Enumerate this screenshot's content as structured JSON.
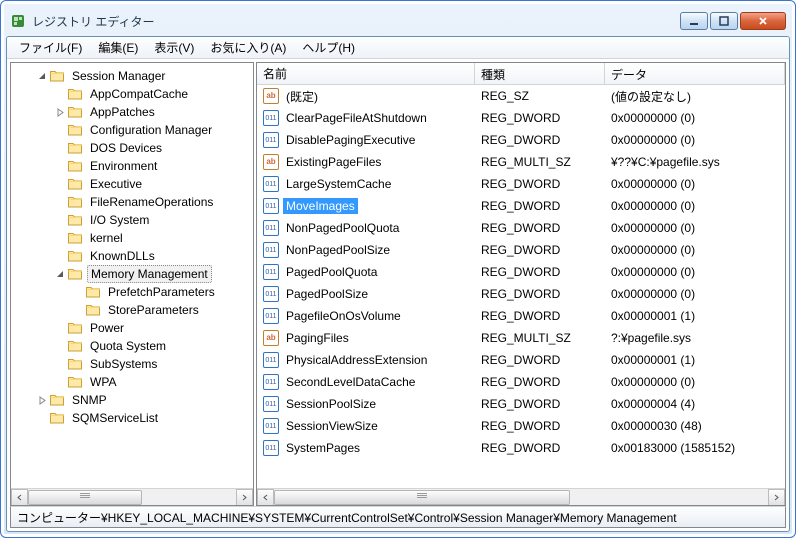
{
  "title": "レジストリ エディター",
  "menus": [
    "ファイル(F)",
    "編集(E)",
    "表示(V)",
    "お気に入り(A)",
    "ヘルプ(H)"
  ],
  "columns": {
    "name": "名前",
    "type": "種類",
    "data": "データ"
  },
  "tree": {
    "items": [
      {
        "label": "Session Manager",
        "indent": 0,
        "exp": "open"
      },
      {
        "label": "AppCompatCache",
        "indent": 1,
        "exp": "none"
      },
      {
        "label": "AppPatches",
        "indent": 1,
        "exp": "closed"
      },
      {
        "label": "Configuration Manager",
        "indent": 1,
        "exp": "none"
      },
      {
        "label": "DOS Devices",
        "indent": 1,
        "exp": "none"
      },
      {
        "label": "Environment",
        "indent": 1,
        "exp": "none"
      },
      {
        "label": "Executive",
        "indent": 1,
        "exp": "none"
      },
      {
        "label": "FileRenameOperations",
        "indent": 1,
        "exp": "none"
      },
      {
        "label": "I/O System",
        "indent": 1,
        "exp": "none"
      },
      {
        "label": "kernel",
        "indent": 1,
        "exp": "none"
      },
      {
        "label": "KnownDLLs",
        "indent": 1,
        "exp": "none"
      },
      {
        "label": "Memory Management",
        "indent": 1,
        "exp": "open",
        "selected": true
      },
      {
        "label": "PrefetchParameters",
        "indent": 2,
        "exp": "none"
      },
      {
        "label": "StoreParameters",
        "indent": 2,
        "exp": "none"
      },
      {
        "label": "Power",
        "indent": 1,
        "exp": "none"
      },
      {
        "label": "Quota System",
        "indent": 1,
        "exp": "none"
      },
      {
        "label": "SubSystems",
        "indent": 1,
        "exp": "none"
      },
      {
        "label": "WPA",
        "indent": 1,
        "exp": "none"
      },
      {
        "label": "SNMP",
        "indent": 0,
        "exp": "closed"
      },
      {
        "label": "SQMServiceList",
        "indent": 0,
        "exp": "none"
      }
    ]
  },
  "values": [
    {
      "name": "(既定)",
      "type": "REG_SZ",
      "data": "(値の設定なし)",
      "icon": "sz"
    },
    {
      "name": "ClearPageFileAtShutdown",
      "type": "REG_DWORD",
      "data": "0x00000000 (0)",
      "icon": "bin"
    },
    {
      "name": "DisablePagingExecutive",
      "type": "REG_DWORD",
      "data": "0x00000000 (0)",
      "icon": "bin"
    },
    {
      "name": "ExistingPageFiles",
      "type": "REG_MULTI_SZ",
      "data": "¥??¥C:¥pagefile.sys",
      "icon": "sz"
    },
    {
      "name": "LargeSystemCache",
      "type": "REG_DWORD",
      "data": "0x00000000 (0)",
      "icon": "bin"
    },
    {
      "name": "MoveImages",
      "type": "REG_DWORD",
      "data": "0x00000000 (0)",
      "icon": "bin",
      "selected": true
    },
    {
      "name": "NonPagedPoolQuota",
      "type": "REG_DWORD",
      "data": "0x00000000 (0)",
      "icon": "bin"
    },
    {
      "name": "NonPagedPoolSize",
      "type": "REG_DWORD",
      "data": "0x00000000 (0)",
      "icon": "bin"
    },
    {
      "name": "PagedPoolQuota",
      "type": "REG_DWORD",
      "data": "0x00000000 (0)",
      "icon": "bin"
    },
    {
      "name": "PagedPoolSize",
      "type": "REG_DWORD",
      "data": "0x00000000 (0)",
      "icon": "bin"
    },
    {
      "name": "PagefileOnOsVolume",
      "type": "REG_DWORD",
      "data": "0x00000001 (1)",
      "icon": "bin"
    },
    {
      "name": "PagingFiles",
      "type": "REG_MULTI_SZ",
      "data": "?:¥pagefile.sys",
      "icon": "sz"
    },
    {
      "name": "PhysicalAddressExtension",
      "type": "REG_DWORD",
      "data": "0x00000001 (1)",
      "icon": "bin"
    },
    {
      "name": "SecondLevelDataCache",
      "type": "REG_DWORD",
      "data": "0x00000000 (0)",
      "icon": "bin"
    },
    {
      "name": "SessionPoolSize",
      "type": "REG_DWORD",
      "data": "0x00000004 (4)",
      "icon": "bin"
    },
    {
      "name": "SessionViewSize",
      "type": "REG_DWORD",
      "data": "0x00000030 (48)",
      "icon": "bin"
    },
    {
      "name": "SystemPages",
      "type": "REG_DWORD",
      "data": "0x00183000 (1585152)",
      "icon": "bin"
    }
  ],
  "status": "コンピューター¥HKEY_LOCAL_MACHINE¥SYSTEM¥CurrentControlSet¥Control¥Session Manager¥Memory Management"
}
